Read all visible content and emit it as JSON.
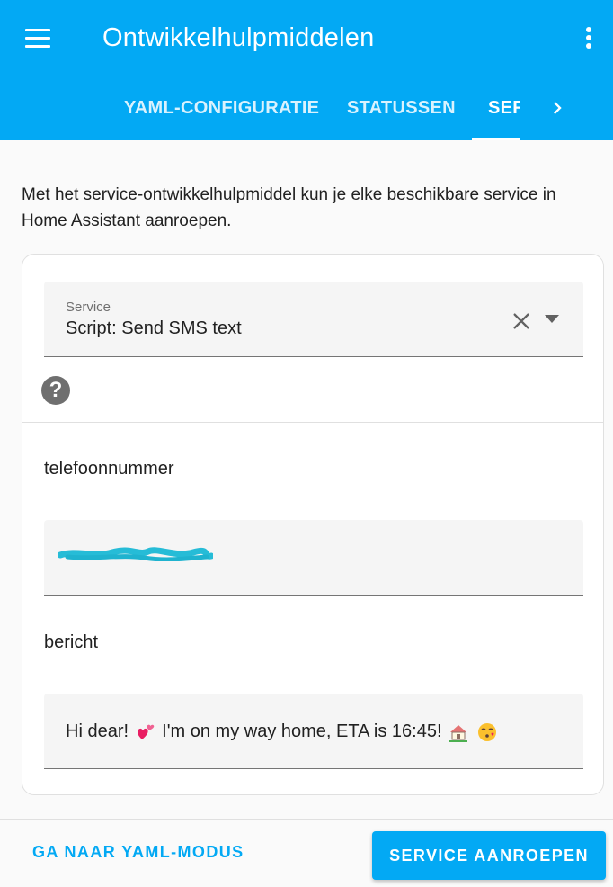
{
  "header": {
    "title": "Ontwikkelhulpmiddelen",
    "background_color": "#03a9f4",
    "menu_icon": "hamburger-menu-icon",
    "overflow_icon": "kebab-menu-icon",
    "tabs": [
      {
        "label": "YAML-CONFIGURATIE",
        "active": false
      },
      {
        "label": "STATUSSEN",
        "active": false
      },
      {
        "label": "SER",
        "active": true
      }
    ],
    "next_tabs_icon": "chevron-right-icon"
  },
  "main": {
    "description": "Met het service-ontwikkelhulpmiddel kun je elke beschikbare service in Home Assistant aanroepen.",
    "service": {
      "label": "Service",
      "value": "Script: Send SMS text",
      "clear_icon": "close-icon",
      "dropdown_icon": "caret-down-icon"
    },
    "help_icon": "question-mark-icon",
    "help_glyph": "?",
    "fields": [
      {
        "label": "telefoonnummer",
        "value_redacted": true
      },
      {
        "label": "bericht",
        "value_before": "Hi dear!",
        "value_middle": "I'm on my way home, ETA is 16:45!",
        "emoji": [
          "two-hearts",
          "house-with-garden",
          "face-blowing-kiss"
        ]
      }
    ]
  },
  "footer": {
    "yaml_mode_label": "GA NAAR YAML-MODUS",
    "call_service_label": "SERVICE AANROEPEN",
    "accent_color": "#03a9f4"
  }
}
